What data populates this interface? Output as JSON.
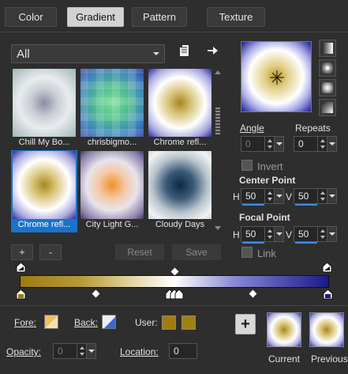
{
  "tabs": [
    {
      "label": "Color"
    },
    {
      "label": "Gradient"
    },
    {
      "label": "Pattern"
    },
    {
      "label": "Texture"
    }
  ],
  "active_tab": "Gradient",
  "category_select": {
    "value": "All"
  },
  "presets": [
    {
      "name": "Chill My Bo..."
    },
    {
      "name": "chrisbigmo..."
    },
    {
      "name": "Chrome refl..."
    },
    {
      "name": "Chrome refl...",
      "selected": true
    },
    {
      "name": "City Light G..."
    },
    {
      "name": "Cloudy Days"
    }
  ],
  "preset_buttons": {
    "add": "+",
    "remove": "-",
    "reset": "Reset",
    "save": "Save"
  },
  "angle": {
    "label": "Angle",
    "value": "0"
  },
  "repeats": {
    "label": "Repeats",
    "value": "0"
  },
  "invert": {
    "label": "Invert",
    "checked": false
  },
  "center_point": {
    "label": "Center Point",
    "h_label": "H",
    "h": "50",
    "v_label": "V",
    "v": "50"
  },
  "focal_point": {
    "label": "Focal Point",
    "h_label": "H",
    "h": "50",
    "v_label": "V",
    "v": "50"
  },
  "link": {
    "label": "Link",
    "checked": false
  },
  "fore": {
    "label": "Fore:"
  },
  "back": {
    "label": "Back:"
  },
  "user": {
    "label": "User:",
    "color1": "#a07c10",
    "color2": "#a08010"
  },
  "opacity": {
    "label": "Opacity:",
    "value": "0"
  },
  "location": {
    "label": "Location:",
    "value": "0"
  },
  "add_button": "+",
  "current": {
    "label": "Current"
  },
  "previous": {
    "label": "Previous"
  },
  "colors": {
    "accent": "#1a73c9",
    "gold": "#a07c10",
    "navy": "#1a1a8a"
  }
}
